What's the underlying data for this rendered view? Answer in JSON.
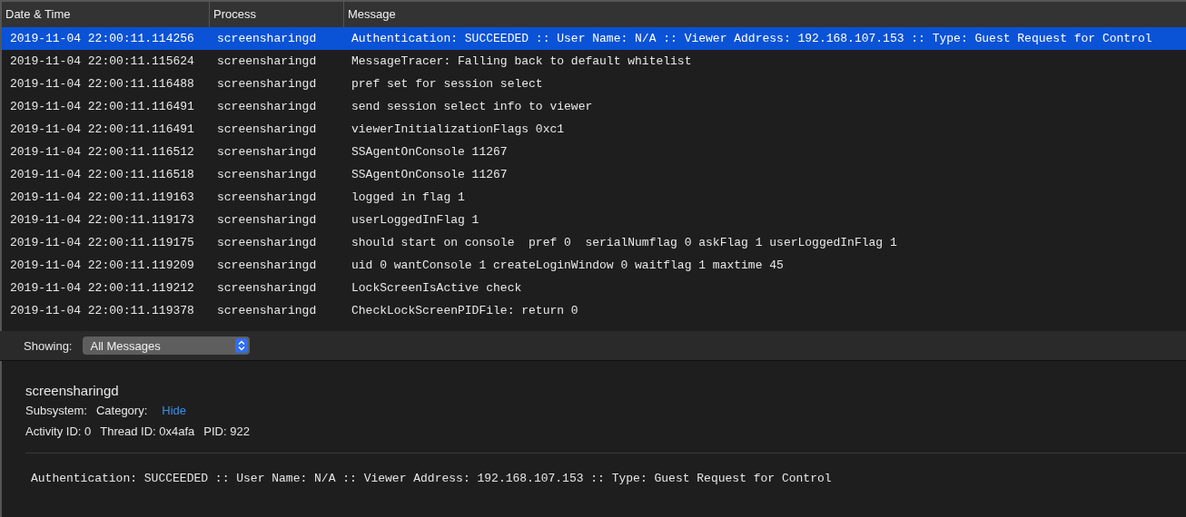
{
  "table": {
    "columns": [
      "Date & Time",
      "Process",
      "Message"
    ],
    "rows": [
      {
        "time": "2019-11-04 22:00:11.114256",
        "process": "screensharingd",
        "message": "Authentication: SUCCEEDED :: User Name: N/A :: Viewer Address: 192.168.107.153 :: Type: Guest Request for Control",
        "selected": true
      },
      {
        "time": "2019-11-04 22:00:11.115624",
        "process": "screensharingd",
        "message": "MessageTracer: Falling back to default whitelist",
        "selected": false
      },
      {
        "time": "2019-11-04 22:00:11.116488",
        "process": "screensharingd",
        "message": "pref set for session select",
        "selected": false
      },
      {
        "time": "2019-11-04 22:00:11.116491",
        "process": "screensharingd",
        "message": "send session select info to viewer",
        "selected": false
      },
      {
        "time": "2019-11-04 22:00:11.116491",
        "process": "screensharingd",
        "message": "viewerInitializationFlags 0xc1",
        "selected": false
      },
      {
        "time": "2019-11-04 22:00:11.116512",
        "process": "screensharingd",
        "message": "SSAgentOnConsole 11267",
        "selected": false
      },
      {
        "time": "2019-11-04 22:00:11.116518",
        "process": "screensharingd",
        "message": "SSAgentOnConsole 11267",
        "selected": false
      },
      {
        "time": "2019-11-04 22:00:11.119163",
        "process": "screensharingd",
        "message": "logged in flag 1",
        "selected": false
      },
      {
        "time": "2019-11-04 22:00:11.119173",
        "process": "screensharingd",
        "message": "userLoggedInFlag 1",
        "selected": false
      },
      {
        "time": "2019-11-04 22:00:11.119175",
        "process": "screensharingd",
        "message": "should start on console  pref 0  serialNumflag 0 askFlag 1 userLoggedInFlag 1",
        "selected": false
      },
      {
        "time": "2019-11-04 22:00:11.119209",
        "process": "screensharingd",
        "message": "uid 0 wantConsole 1 createLoginWindow 0 waitflag 1 maxtime 45",
        "selected": false
      },
      {
        "time": "2019-11-04 22:00:11.119212",
        "process": "screensharingd",
        "message": "LockScreenIsActive check",
        "selected": false
      },
      {
        "time": "2019-11-04 22:00:11.119378",
        "process": "screensharingd",
        "message": "CheckLockScreenPIDFile: return 0",
        "selected": false
      }
    ]
  },
  "filter": {
    "label": "Showing:",
    "value": "All Messages"
  },
  "detail": {
    "process": "screensharingd",
    "subsystem_label": "Subsystem:",
    "category_label": "Category:",
    "hide_link": "Hide",
    "activity_id": "Activity ID: 0",
    "thread_id": "Thread ID: 0x4afa",
    "pid": "PID: 922",
    "message": "Authentication: SUCCEEDED :: User Name: N/A :: Viewer Address: 192.168.107.153 :: Type: Guest Request for Control"
  }
}
